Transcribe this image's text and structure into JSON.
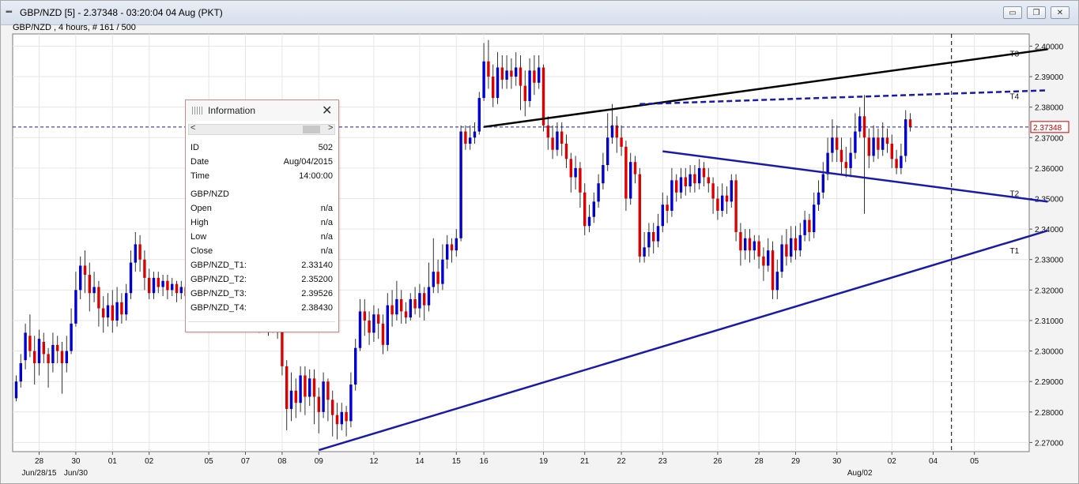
{
  "window": {
    "title": "GBP/NZD [5] - 2.37348 - 03:20:04  04 Aug (PKT)",
    "subtitle": "GBP/NZD , 4 hours, # 161 / 500",
    "min_glyph": "▭",
    "max_glyph": "❐",
    "close_glyph": "✕"
  },
  "info_panel": {
    "title": "Information",
    "close_glyph": "✕",
    "scroll_left": "<",
    "scroll_right": ">",
    "rows": [
      {
        "label": "ID",
        "value": "502"
      },
      {
        "label": "Date",
        "value": "Aug/04/2015"
      },
      {
        "label": "Time",
        "value": "14:00:00"
      },
      {
        "label": "GBP/NZD",
        "value": ""
      },
      {
        "label": "Open",
        "value": "n/a"
      },
      {
        "label": "High",
        "value": "n/a"
      },
      {
        "label": "Low",
        "value": "n/a"
      },
      {
        "label": "Close",
        "value": "n/a"
      },
      {
        "label": "GBP/NZD_T1:",
        "value": "2.33140"
      },
      {
        "label": "GBP/NZD_T2:",
        "value": "2.35200"
      },
      {
        "label": "GBP/NZD_T3:",
        "value": "2.39526"
      },
      {
        "label": "GBP/NZD_T4:",
        "value": "2.38430"
      }
    ]
  },
  "colors": {
    "bull": "#0000cc",
    "bear": "#dd0000",
    "wick": "#333333",
    "trend_blue": "#1a1aaa",
    "trend_black": "#000000"
  },
  "chart_data": {
    "type": "candlestick",
    "title": "",
    "symbol": "GBP/NZD",
    "timeframe": "4 hours",
    "ylim": [
      2.267,
      2.404
    ],
    "yticks": [
      2.27,
      2.28,
      2.29,
      2.3,
      2.31,
      2.32,
      2.33,
      2.34,
      2.35,
      2.36,
      2.37,
      2.38,
      2.39,
      2.4
    ],
    "ytick_labels": [
      "2.27000",
      "2.28000",
      "2.29000",
      "2.30000",
      "2.31000",
      "2.32000",
      "2.33000",
      "2.34000",
      "2.35000",
      "2.36000",
      "2.37000",
      "2.38000",
      "2.39000",
      "2.40000"
    ],
    "xticks": [
      {
        "index": 5,
        "label": "28"
      },
      {
        "index": 13,
        "label": "30"
      },
      {
        "index": 21,
        "label": "01"
      },
      {
        "index": 29,
        "label": "02"
      },
      {
        "index": 42,
        "label": "05"
      },
      {
        "index": 50,
        "label": "07"
      },
      {
        "index": 58,
        "label": "08"
      },
      {
        "index": 66,
        "label": "09"
      },
      {
        "index": 78,
        "label": "12"
      },
      {
        "index": 88,
        "label": "14"
      },
      {
        "index": 96,
        "label": "15"
      },
      {
        "index": 102,
        "label": "16"
      },
      {
        "index": 115,
        "label": "19"
      },
      {
        "index": 124,
        "label": "21"
      },
      {
        "index": 132,
        "label": "22"
      },
      {
        "index": 141,
        "label": "23"
      },
      {
        "index": 153,
        "label": "26"
      },
      {
        "index": 162,
        "label": "28"
      },
      {
        "index": 170,
        "label": "29"
      },
      {
        "index": 179,
        "label": "30"
      },
      {
        "index": 191,
        "label": "02"
      },
      {
        "index": 200,
        "label": "04"
      },
      {
        "index": 209,
        "label": "05"
      }
    ],
    "month_labels": [
      {
        "index": 5,
        "label": "Jun/28/15"
      },
      {
        "index": 13,
        "label": "Jun/30"
      },
      {
        "index": 184,
        "label": "Aug/02"
      }
    ],
    "last_price": 2.37348,
    "last_price_label": "2.37348",
    "cursor_index": 204,
    "trendlines": [
      {
        "name": "T1",
        "style": "solid",
        "color": "#1a1aaa",
        "start": [
          66,
          2.2675
        ],
        "end": [
          225,
          2.3395
        ]
      },
      {
        "name": "T2",
        "style": "solid",
        "color": "#1a1aaa",
        "start": [
          141,
          2.3655
        ],
        "end": [
          225,
          2.349
        ]
      },
      {
        "name": "T3",
        "style": "solid",
        "color": "#000000",
        "start": [
          102,
          2.3735
        ],
        "end": [
          225,
          2.399
        ]
      },
      {
        "name": "T4",
        "style": "dashed",
        "color": "#1a1aaa",
        "start": [
          136,
          2.381
        ],
        "end": [
          225,
          2.3855
        ]
      }
    ],
    "candles": [
      [
        2.2845,
        2.29,
        2.2835,
        2.292
      ],
      [
        2.29,
        2.296,
        2.288,
        2.299
      ],
      [
        2.297,
        2.306,
        2.294,
        2.309
      ],
      [
        2.305,
        2.3,
        2.298,
        2.312
      ],
      [
        2.3,
        2.296,
        2.289,
        2.305
      ],
      [
        2.296,
        2.304,
        2.292,
        2.307
      ],
      [
        2.303,
        2.299,
        2.296,
        2.306
      ],
      [
        2.299,
        2.296,
        2.288,
        2.301
      ],
      [
        2.296,
        2.302,
        2.293,
        2.306
      ],
      [
        2.302,
        2.3,
        2.296,
        2.305
      ],
      [
        2.3,
        2.296,
        2.286,
        2.303
      ],
      [
        2.296,
        2.3,
        2.293,
        2.305
      ],
      [
        2.3,
        2.309,
        2.299,
        2.314
      ],
      [
        2.309,
        2.32,
        2.308,
        2.326
      ],
      [
        2.32,
        2.328,
        2.317,
        2.331
      ],
      [
        2.328,
        2.325,
        2.319,
        2.333
      ],
      [
        2.325,
        2.319,
        2.313,
        2.329
      ],
      [
        2.319,
        2.321,
        2.316,
        2.326
      ],
      [
        2.321,
        2.314,
        2.308,
        2.323
      ],
      [
        2.314,
        2.311,
        2.306,
        2.318
      ],
      [
        2.311,
        2.315,
        2.308,
        2.319
      ],
      [
        2.315,
        2.31,
        2.306,
        2.32
      ],
      [
        2.31,
        2.316,
        2.308,
        2.321
      ],
      [
        2.316,
        2.312,
        2.309,
        2.319
      ],
      [
        2.312,
        2.319,
        2.31,
        2.322
      ],
      [
        2.319,
        2.329,
        2.317,
        2.333
      ],
      [
        2.329,
        2.335,
        2.326,
        2.339
      ],
      [
        2.335,
        2.33,
        2.326,
        2.338
      ],
      [
        2.33,
        2.324,
        2.32,
        2.333
      ],
      [
        2.324,
        2.319,
        2.317,
        2.327
      ],
      [
        2.319,
        2.324,
        2.317,
        2.326
      ],
      [
        2.324,
        2.321,
        2.319,
        2.326
      ],
      [
        2.321,
        2.323,
        2.318,
        2.325
      ],
      [
        2.323,
        2.32,
        2.317,
        2.325
      ],
      [
        2.32,
        2.322,
        2.318,
        2.324
      ],
      [
        2.322,
        2.319,
        2.316,
        2.323
      ],
      [
        2.319,
        2.321,
        2.317,
        2.323
      ],
      [
        2.321,
        2.318,
        2.315,
        2.322
      ],
      [
        2.318,
        2.32,
        2.315,
        2.322
      ],
      [
        2.32,
        2.317,
        2.313,
        2.321
      ],
      [
        2.317,
        2.319,
        2.314,
        2.321
      ],
      [
        2.319,
        2.316,
        2.312,
        2.32
      ],
      [
        2.316,
        2.318,
        2.313,
        2.32
      ],
      [
        2.318,
        2.315,
        2.311,
        2.319
      ],
      [
        2.315,
        2.317,
        2.312,
        2.319
      ],
      [
        2.317,
        2.314,
        2.31,
        2.318
      ],
      [
        2.314,
        2.316,
        2.311,
        2.318
      ],
      [
        2.316,
        2.313,
        2.309,
        2.317
      ],
      [
        2.313,
        2.315,
        2.31,
        2.317
      ],
      [
        2.315,
        2.312,
        2.308,
        2.316
      ],
      [
        2.312,
        2.314,
        2.309,
        2.316
      ],
      [
        2.314,
        2.311,
        2.307,
        2.315
      ],
      [
        2.311,
        2.313,
        2.308,
        2.315
      ],
      [
        2.313,
        2.31,
        2.306,
        2.314
      ],
      [
        2.31,
        2.312,
        2.307,
        2.314
      ],
      [
        2.312,
        2.309,
        2.305,
        2.313
      ],
      [
        2.309,
        2.311,
        2.306,
        2.313
      ],
      [
        2.311,
        2.308,
        2.304,
        2.312
      ],
      [
        2.308,
        2.295,
        2.292,
        2.311
      ],
      [
        2.295,
        2.281,
        2.274,
        2.297
      ],
      [
        2.281,
        2.287,
        2.277,
        2.293
      ],
      [
        2.287,
        2.283,
        2.278,
        2.291
      ],
      [
        2.283,
        2.292,
        2.28,
        2.295
      ],
      [
        2.292,
        2.285,
        2.279,
        2.295
      ],
      [
        2.285,
        2.291,
        2.282,
        2.294
      ],
      [
        2.291,
        2.285,
        2.276,
        2.294
      ],
      [
        2.285,
        2.28,
        2.273,
        2.288
      ],
      [
        2.28,
        2.29,
        2.278,
        2.293
      ],
      [
        2.29,
        2.284,
        2.277,
        2.291
      ],
      [
        2.284,
        2.279,
        2.272,
        2.287
      ],
      [
        2.279,
        2.276,
        2.271,
        2.283
      ],
      [
        2.276,
        2.28,
        2.274,
        2.283
      ],
      [
        2.28,
        2.277,
        2.272,
        2.282
      ],
      [
        2.277,
        2.289,
        2.275,
        2.293
      ],
      [
        2.289,
        2.301,
        2.287,
        2.304
      ],
      [
        2.301,
        2.313,
        2.3,
        2.317
      ],
      [
        2.313,
        2.31,
        2.305,
        2.317
      ],
      [
        2.31,
        2.306,
        2.302,
        2.313
      ],
      [
        2.306,
        2.312,
        2.303,
        2.315
      ],
      [
        2.312,
        2.309,
        2.304,
        2.314
      ],
      [
        2.309,
        2.302,
        2.299,
        2.312
      ],
      [
        2.302,
        2.315,
        2.3,
        2.319
      ],
      [
        2.315,
        2.312,
        2.308,
        2.32
      ],
      [
        2.312,
        2.317,
        2.31,
        2.323
      ],
      [
        2.317,
        2.313,
        2.309,
        2.32
      ],
      [
        2.313,
        2.311,
        2.309,
        2.316
      ],
      [
        2.311,
        2.317,
        2.31,
        2.319
      ],
      [
        2.317,
        2.314,
        2.312,
        2.321
      ],
      [
        2.314,
        2.319,
        2.311,
        2.322
      ],
      [
        2.319,
        2.315,
        2.31,
        2.321
      ],
      [
        2.315,
        2.321,
        2.313,
        2.329
      ],
      [
        2.321,
        2.326,
        2.319,
        2.337
      ],
      [
        2.326,
        2.322,
        2.319,
        2.33
      ],
      [
        2.322,
        2.33,
        2.32,
        2.335
      ],
      [
        2.33,
        2.335,
        2.327,
        2.338
      ],
      [
        2.335,
        2.333,
        2.329,
        2.337
      ],
      [
        2.333,
        2.337,
        2.331,
        2.34
      ],
      [
        2.337,
        2.372,
        2.336,
        2.374
      ],
      [
        2.372,
        2.368,
        2.366,
        2.374
      ],
      [
        2.368,
        2.37,
        2.366,
        2.374
      ],
      [
        2.37,
        2.372,
        2.368,
        2.375
      ],
      [
        2.372,
        2.383,
        2.371,
        2.385
      ],
      [
        2.383,
        2.395,
        2.382,
        2.401
      ],
      [
        2.395,
        2.39,
        2.386,
        2.402
      ],
      [
        2.39,
        2.383,
        2.38,
        2.394
      ],
      [
        2.383,
        2.393,
        2.381,
        2.398
      ],
      [
        2.393,
        2.389,
        2.386,
        2.397
      ],
      [
        2.389,
        2.392,
        2.386,
        2.397
      ],
      [
        2.392,
        2.39,
        2.386,
        2.396
      ],
      [
        2.39,
        2.393,
        2.387,
        2.398
      ],
      [
        2.393,
        2.387,
        2.379,
        2.397
      ],
      [
        2.387,
        2.382,
        2.377,
        2.392
      ],
      [
        2.382,
        2.392,
        2.38,
        2.396
      ],
      [
        2.392,
        2.388,
        2.384,
        2.397
      ],
      [
        2.388,
        2.393,
        2.386,
        2.397
      ],
      [
        2.393,
        2.374,
        2.372,
        2.394
      ],
      [
        2.374,
        2.37,
        2.366,
        2.377
      ],
      [
        2.37,
        2.366,
        2.363,
        2.374
      ],
      [
        2.366,
        2.372,
        2.364,
        2.375
      ],
      [
        2.372,
        2.368,
        2.364,
        2.375
      ],
      [
        2.368,
        2.363,
        2.36,
        2.371
      ],
      [
        2.363,
        2.357,
        2.352,
        2.365
      ],
      [
        2.357,
        2.36,
        2.353,
        2.364
      ],
      [
        2.36,
        2.352,
        2.347,
        2.362
      ],
      [
        2.352,
        2.341,
        2.338,
        2.355
      ],
      [
        2.341,
        2.344,
        2.339,
        2.348
      ],
      [
        2.344,
        2.349,
        2.342,
        2.352
      ],
      [
        2.349,
        2.355,
        2.347,
        2.358
      ],
      [
        2.355,
        2.361,
        2.353,
        2.365
      ],
      [
        2.361,
        2.37,
        2.359,
        2.378
      ],
      [
        2.37,
        2.374,
        2.368,
        2.381
      ],
      [
        2.374,
        2.37,
        2.365,
        2.377
      ],
      [
        2.37,
        2.367,
        2.364,
        2.374
      ],
      [
        2.367,
        2.35,
        2.346,
        2.369
      ],
      [
        2.35,
        2.362,
        2.348,
        2.365
      ],
      [
        2.362,
        2.358,
        2.355,
        2.364
      ],
      [
        2.358,
        2.331,
        2.329,
        2.36
      ],
      [
        2.331,
        2.334,
        2.329,
        2.339
      ],
      [
        2.334,
        2.339,
        2.331,
        2.342
      ],
      [
        2.339,
        2.336,
        2.332,
        2.342
      ],
      [
        2.336,
        2.341,
        2.334,
        2.345
      ],
      [
        2.341,
        2.348,
        2.339,
        2.352
      ],
      [
        2.348,
        2.346,
        2.342,
        2.351
      ],
      [
        2.346,
        2.356,
        2.344,
        2.36
      ],
      [
        2.356,
        2.352,
        2.349,
        2.358
      ],
      [
        2.352,
        2.357,
        2.35,
        2.36
      ],
      [
        2.357,
        2.354,
        2.351,
        2.36
      ],
      [
        2.354,
        2.358,
        2.352,
        2.361
      ],
      [
        2.358,
        2.355,
        2.352,
        2.361
      ],
      [
        2.355,
        2.36,
        2.353,
        2.363
      ],
      [
        2.36,
        2.357,
        2.354,
        2.362
      ],
      [
        2.357,
        2.355,
        2.352,
        2.36
      ],
      [
        2.355,
        2.35,
        2.345,
        2.357
      ],
      [
        2.35,
        2.346,
        2.343,
        2.354
      ],
      [
        2.346,
        2.351,
        2.344,
        2.355
      ],
      [
        2.351,
        2.349,
        2.345,
        2.354
      ],
      [
        2.349,
        2.356,
        2.347,
        2.358
      ],
      [
        2.356,
        2.339,
        2.336,
        2.358
      ],
      [
        2.339,
        2.333,
        2.328,
        2.342
      ],
      [
        2.333,
        2.337,
        2.33,
        2.34
      ],
      [
        2.337,
        2.333,
        2.329,
        2.34
      ],
      [
        2.333,
        2.336,
        2.33,
        2.338
      ],
      [
        2.336,
        2.331,
        2.327,
        2.338
      ],
      [
        2.331,
        2.328,
        2.323,
        2.334
      ],
      [
        2.328,
        2.333,
        2.326,
        2.337
      ],
      [
        2.333,
        2.32,
        2.317,
        2.336
      ],
      [
        2.32,
        2.326,
        2.317,
        2.33
      ],
      [
        2.326,
        2.335,
        2.324,
        2.338
      ],
      [
        2.335,
        2.331,
        2.328,
        2.34
      ],
      [
        2.331,
        2.337,
        2.329,
        2.341
      ],
      [
        2.337,
        2.333,
        2.33,
        2.341
      ],
      [
        2.333,
        2.338,
        2.331,
        2.342
      ],
      [
        2.338,
        2.343,
        2.336,
        2.346
      ],
      [
        2.343,
        2.339,
        2.336,
        2.345
      ],
      [
        2.339,
        2.348,
        2.337,
        2.352
      ],
      [
        2.348,
        2.352,
        2.346,
        2.356
      ],
      [
        2.352,
        2.358,
        2.35,
        2.362
      ],
      [
        2.358,
        2.365,
        2.356,
        2.37
      ],
      [
        2.365,
        2.37,
        2.362,
        2.376
      ],
      [
        2.37,
        2.366,
        2.362,
        2.374
      ],
      [
        2.366,
        2.362,
        2.358,
        2.37
      ],
      [
        2.362,
        2.36,
        2.357,
        2.367
      ],
      [
        2.36,
        2.365,
        2.357,
        2.37
      ],
      [
        2.365,
        2.372,
        2.363,
        2.378
      ],
      [
        2.372,
        2.377,
        2.37,
        2.38
      ],
      [
        2.377,
        2.37,
        2.345,
        2.384
      ],
      [
        2.37,
        2.364,
        2.36,
        2.373
      ],
      [
        2.364,
        2.37,
        2.362,
        2.374
      ],
      [
        2.37,
        2.366,
        2.363,
        2.373
      ],
      [
        2.366,
        2.37,
        2.364,
        2.375
      ],
      [
        2.37,
        2.368,
        2.365,
        2.373
      ],
      [
        2.368,
        2.363,
        2.36,
        2.371
      ],
      [
        2.363,
        2.36,
        2.358,
        2.366
      ],
      [
        2.36,
        2.364,
        2.358,
        2.368
      ],
      [
        2.364,
        2.376,
        2.362,
        2.379
      ],
      [
        2.376,
        2.3735,
        2.372,
        2.378
      ]
    ]
  }
}
